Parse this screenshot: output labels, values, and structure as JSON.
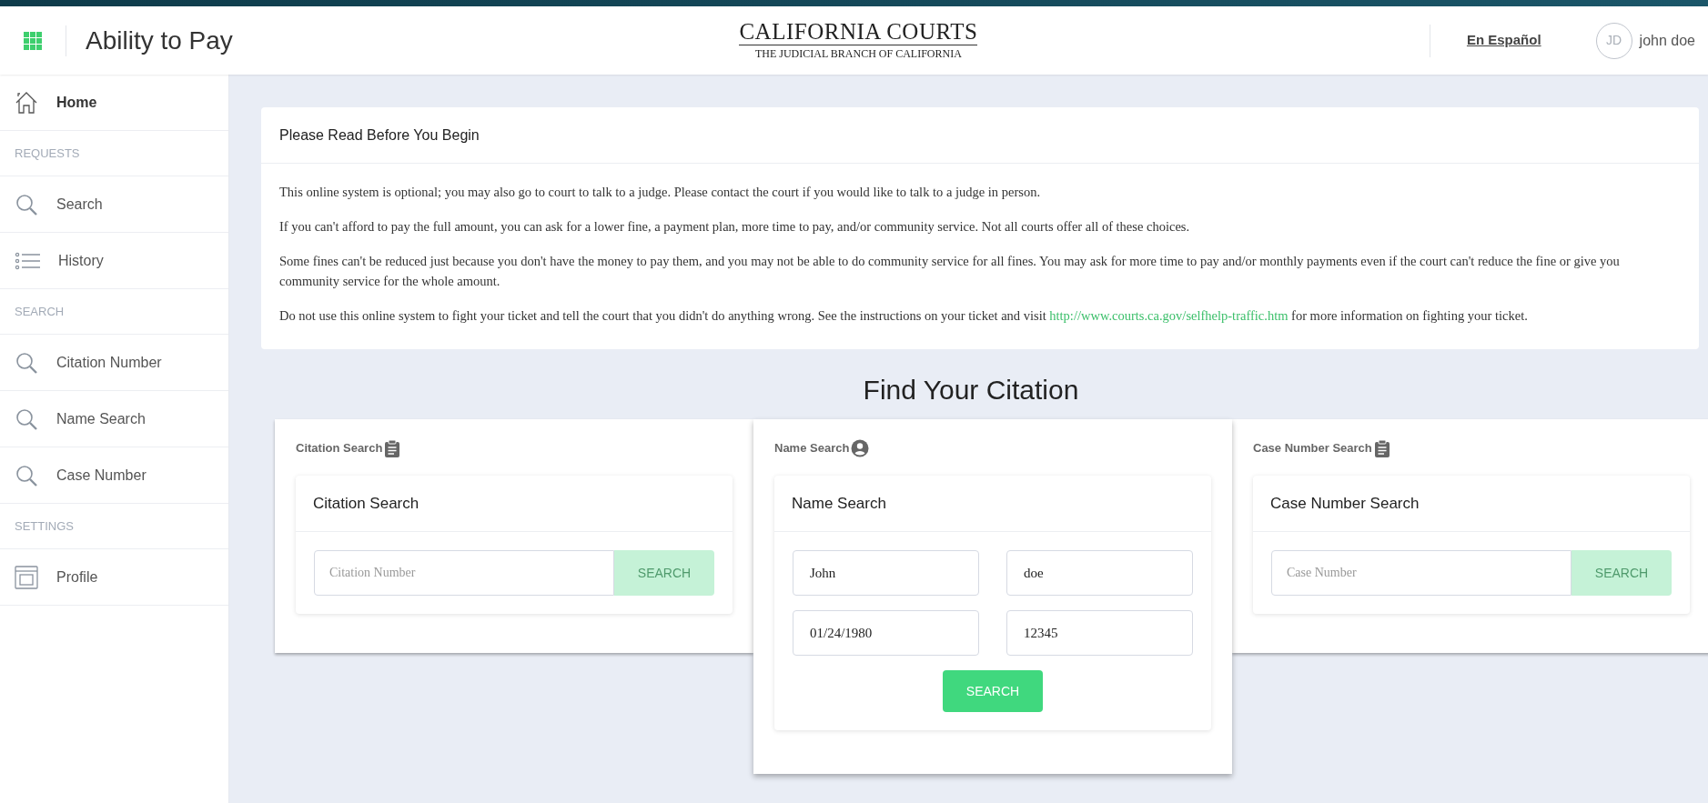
{
  "header": {
    "app_title": "Ability to Pay",
    "logo_title": "CALIFORNIA COURTS",
    "logo_subtitle": "THE JUDICIAL BRANCH OF CALIFORNIA",
    "language_link": "En Español",
    "avatar_initials": "JD",
    "user_name": "john doe"
  },
  "sidebar": {
    "items": [
      {
        "kind": "home",
        "label": "Home",
        "selected": true
      },
      {
        "kind": "section",
        "label": "REQUESTS"
      },
      {
        "kind": "search",
        "label": "Search",
        "selected": false
      },
      {
        "kind": "history",
        "label": "History",
        "selected": false
      },
      {
        "kind": "section",
        "label": "SEARCH"
      },
      {
        "kind": "search",
        "label": "Citation Number",
        "selected": false
      },
      {
        "kind": "search",
        "label": "Name Search",
        "selected": false
      },
      {
        "kind": "search",
        "label": "Case Number",
        "selected": false
      },
      {
        "kind": "section",
        "label": "SETTINGS"
      },
      {
        "kind": "profile",
        "label": "Profile",
        "selected": false
      }
    ]
  },
  "notice": {
    "title": "Please Read Before You Begin",
    "paragraphs": [
      {
        "text": "This online system is optional; you may also go to court to talk to a judge. Please contact the court if you would like to talk to a judge in person."
      },
      {
        "text": "If you can't afford to pay the full amount, you can ask for a lower fine, a payment plan, more time to pay, and/or community service. Not all courts offer all of these choices."
      },
      {
        "text": "Some fines can't be reduced just because you don't have the money to pay them, and you may not be able to do community service for all fines. You may ask for more time to pay and/or monthly payments even if the court can't reduce the fine or give you community service for the whole amount."
      },
      {
        "text": "Do not use this online system to fight your ticket and tell the court that you didn't do anything wrong. See the instructions on your ticket and visit",
        "link": "http://www.courts.ca.gov/selfhelp-traffic.htm",
        "text_after": "for more information on fighting your ticket."
      }
    ]
  },
  "find_title": "Find Your Citation",
  "search_panels": [
    {
      "kind": "citation",
      "tab_label": "Citation Search",
      "selected": false,
      "card_title": "Citation Search",
      "fields": [
        {
          "placeholder": "Citation Number"
        }
      ],
      "button": {
        "label": "SEARCH",
        "disabled": true
      }
    },
    {
      "kind": "name",
      "tab_label": "Name Search",
      "selected": true,
      "card_title": "Name Search",
      "fields": [
        {
          "value": "John"
        },
        {
          "value": "doe"
        },
        {
          "value": "01/24/1980"
        },
        {
          "value": "12345"
        }
      ],
      "button": {
        "label": "SEARCH",
        "disabled": false
      }
    },
    {
      "kind": "case",
      "tab_label": "Case Number Search",
      "selected": false,
      "card_title": "Case Number Search",
      "fields": [
        {
          "placeholder": "Case Number"
        }
      ],
      "button": {
        "label": "SEARCH",
        "disabled": true
      }
    }
  ]
}
